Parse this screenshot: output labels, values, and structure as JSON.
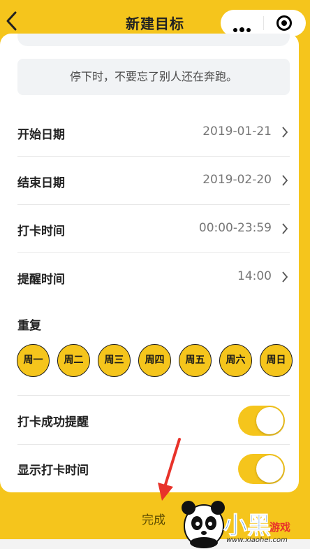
{
  "header": {
    "title": "新建目标",
    "back_icon": "chevron-left-icon",
    "more_icon": "more-dots-icon",
    "close_icon": "target-circle-icon"
  },
  "quote": "停下时，不要忘了别人还在奔跑。",
  "fields": [
    {
      "label": "开始日期",
      "value": "2019-01-21"
    },
    {
      "label": "结束日期",
      "value": "2019-02-20"
    },
    {
      "label": "打卡时间",
      "value": "00:00-23:59"
    },
    {
      "label": "提醒时间",
      "value": "14:00"
    }
  ],
  "repeat": {
    "label": "重复",
    "days": [
      "周一",
      "周二",
      "周三",
      "周四",
      "周五",
      "周六",
      "周日"
    ]
  },
  "toggles": [
    {
      "label": "打卡成功提醒",
      "on": true
    },
    {
      "label": "显示打卡时间",
      "on": true
    }
  ],
  "done_button": "完成",
  "watermark": {
    "brand": "小黑",
    "suffix": "游戏",
    "url": "www.xiaohei.com"
  },
  "colors": {
    "accent": "#f5c51c",
    "annotation_arrow": "#e8322a"
  }
}
